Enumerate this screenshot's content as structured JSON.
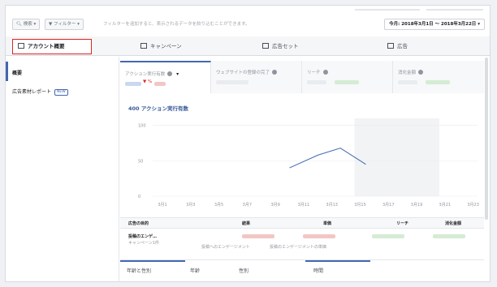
{
  "filterbar": {
    "search_label": "検索",
    "filter_label": "フィルター",
    "note": "フィルターを追加すると、表示されるデータを絞り込むことができます。",
    "date_range": "今月: 2018年3月1日 ～ 2018年3月22日"
  },
  "tabs": [
    {
      "label": "アカウント概要",
      "icon": "account-icon"
    },
    {
      "label": "キャンペーン",
      "icon": "folder-icon"
    },
    {
      "label": "広告セット",
      "icon": "grid-icon"
    },
    {
      "label": "広告",
      "icon": "ad-icon"
    }
  ],
  "sidebar": {
    "items": [
      {
        "label": "概要"
      },
      {
        "label": "広告素材レポート",
        "badge": "NEW"
      }
    ]
  },
  "metrics": [
    {
      "label": "アクション実行有数",
      "delta": "▼ %"
    },
    {
      "label": "ウェブサイトの登録の完了"
    },
    {
      "label": "リーチ"
    },
    {
      "label": "消化金額"
    }
  ],
  "chart_title": "400 アクション実行有数",
  "chart_data": {
    "type": "line",
    "categories": [
      "3月1",
      "3月3",
      "3月5",
      "3月7",
      "3月9",
      "3月11",
      "3月13",
      "3月15",
      "3月17",
      "3月19",
      "3月21",
      "3月23"
    ],
    "yticks": [
      0,
      50,
      100
    ],
    "ylim": [
      0,
      110
    ],
    "segments": [
      [
        [
          4.5,
          40
        ],
        [
          5.5,
          58
        ],
        [
          6.3,
          68
        ],
        [
          7.2,
          45
        ]
      ],
      [
        [
          13.2,
          25
        ],
        [
          14.8,
          65
        ],
        [
          15.6,
          70
        ],
        [
          17.0,
          45
        ],
        [
          18.0,
          40
        ]
      ]
    ]
  },
  "table": {
    "headers": [
      "広告の目的",
      "結果",
      "単価",
      "リーチ",
      "消化金額"
    ],
    "row": {
      "objective": "投稿のエンゲ…",
      "objective_sub": "キャンペーン1件",
      "result_label": "投稿へのエンゲージメント",
      "cost_label": "投稿のエンゲージメントの単価"
    }
  },
  "bottom_tabs": [
    "年齢と性別",
    "年齢",
    "性別",
    "時間"
  ],
  "colors": {
    "accent": "#4267b2",
    "alert": "#e02424"
  }
}
